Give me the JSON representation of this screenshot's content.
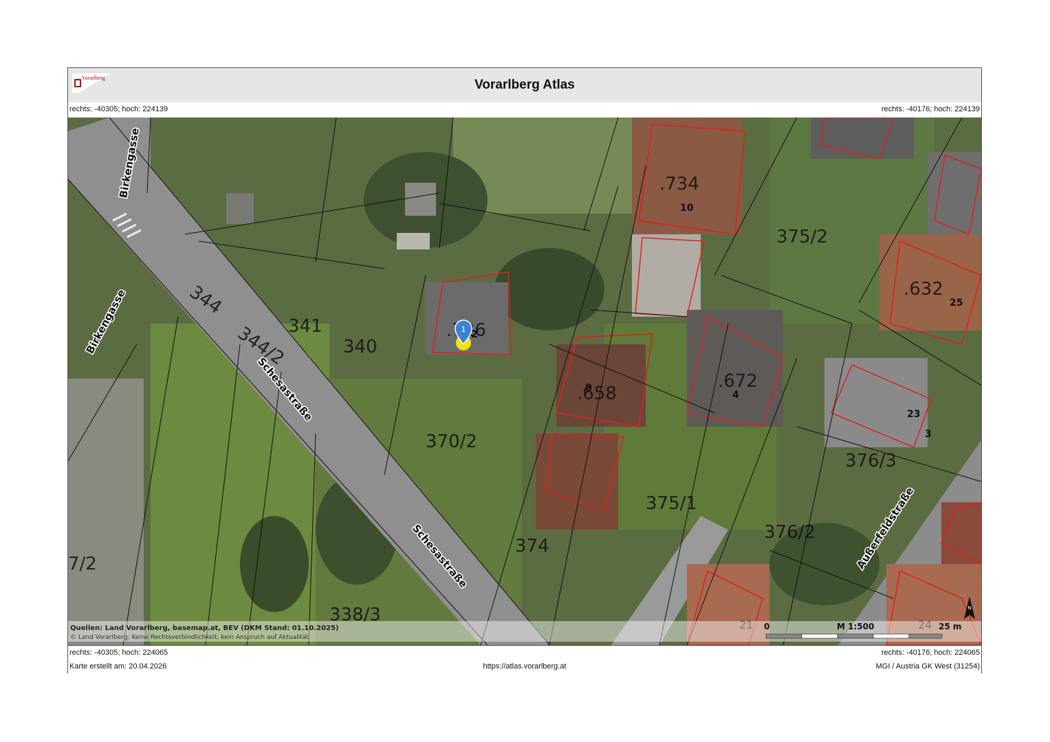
{
  "header": {
    "title": "Vorarlberg Atlas",
    "logo_text": "Vorarlberg"
  },
  "coords": {
    "top_left": "rechts: -40305; hoch: 224139",
    "top_right": "rechts: -40176; hoch: 224139",
    "bottom_left": "rechts: -40305; hoch: 224065",
    "bottom_right": "rechts: -40176; hoch: 224065"
  },
  "footer": {
    "created": "Karte erstellt am: 20.04.2026",
    "url": "https://atlas.vorarlberg.at",
    "crs": "MGI / Austria GK West (31254)"
  },
  "sources": {
    "line1": "Quellen: Land Vorarlberg, basemap.at, BEV (DKM Stand: 01.10.2025)",
    "line2": "© Land Vorarlberg: Keine Rechtsverbindlichkeit, kein Anspruch auf Aktualität"
  },
  "scale": {
    "zero": "0",
    "ratio": "M 1:500",
    "end": "25 m"
  },
  "north_label": "N",
  "marker_number": "1",
  "streets": [
    "Birkengasse",
    "Birkengasse",
    "Schesastraße",
    "Schesastraße",
    "Außerfeldstraße"
  ],
  "parcels": [
    "344",
    "344/2",
    "341",
    "340",
    "370/2",
    "374",
    "338/3",
    "7/2",
    ".734",
    "375/2",
    ".658",
    ".672",
    "375/1",
    ".632",
    "376/3",
    "376/2",
    ".726"
  ],
  "house_numbers": [
    "10",
    "2",
    "8",
    "4",
    "25",
    "23",
    "3",
    "21",
    "24"
  ],
  "colors": {
    "parcel_line": "#111111",
    "building_outline": "#e02020",
    "marker_blue": "#3b82d6",
    "marker_yellow": "#f5e000"
  }
}
